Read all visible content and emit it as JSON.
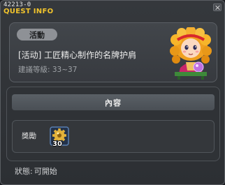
{
  "window": {
    "quest_id": "42213-0",
    "title": "QUEST INFO"
  },
  "quest": {
    "category": "活動",
    "name": "[活动] 工匠精心制作的名牌护肩",
    "level_requirement": "建議等級: 33~37",
    "npc_icon": "fortune-teller-girl-npc-icon"
  },
  "content": {
    "header": "內容",
    "reward_label": "獎勵",
    "reward_item_icon": "gold-gear-item-icon",
    "reward_quantity": "30"
  },
  "status": {
    "label": "狀態:",
    "value": "可開始"
  },
  "colors": {
    "title": "#f3c52c",
    "background": "#2c2f33",
    "badge": "#8e9196"
  }
}
